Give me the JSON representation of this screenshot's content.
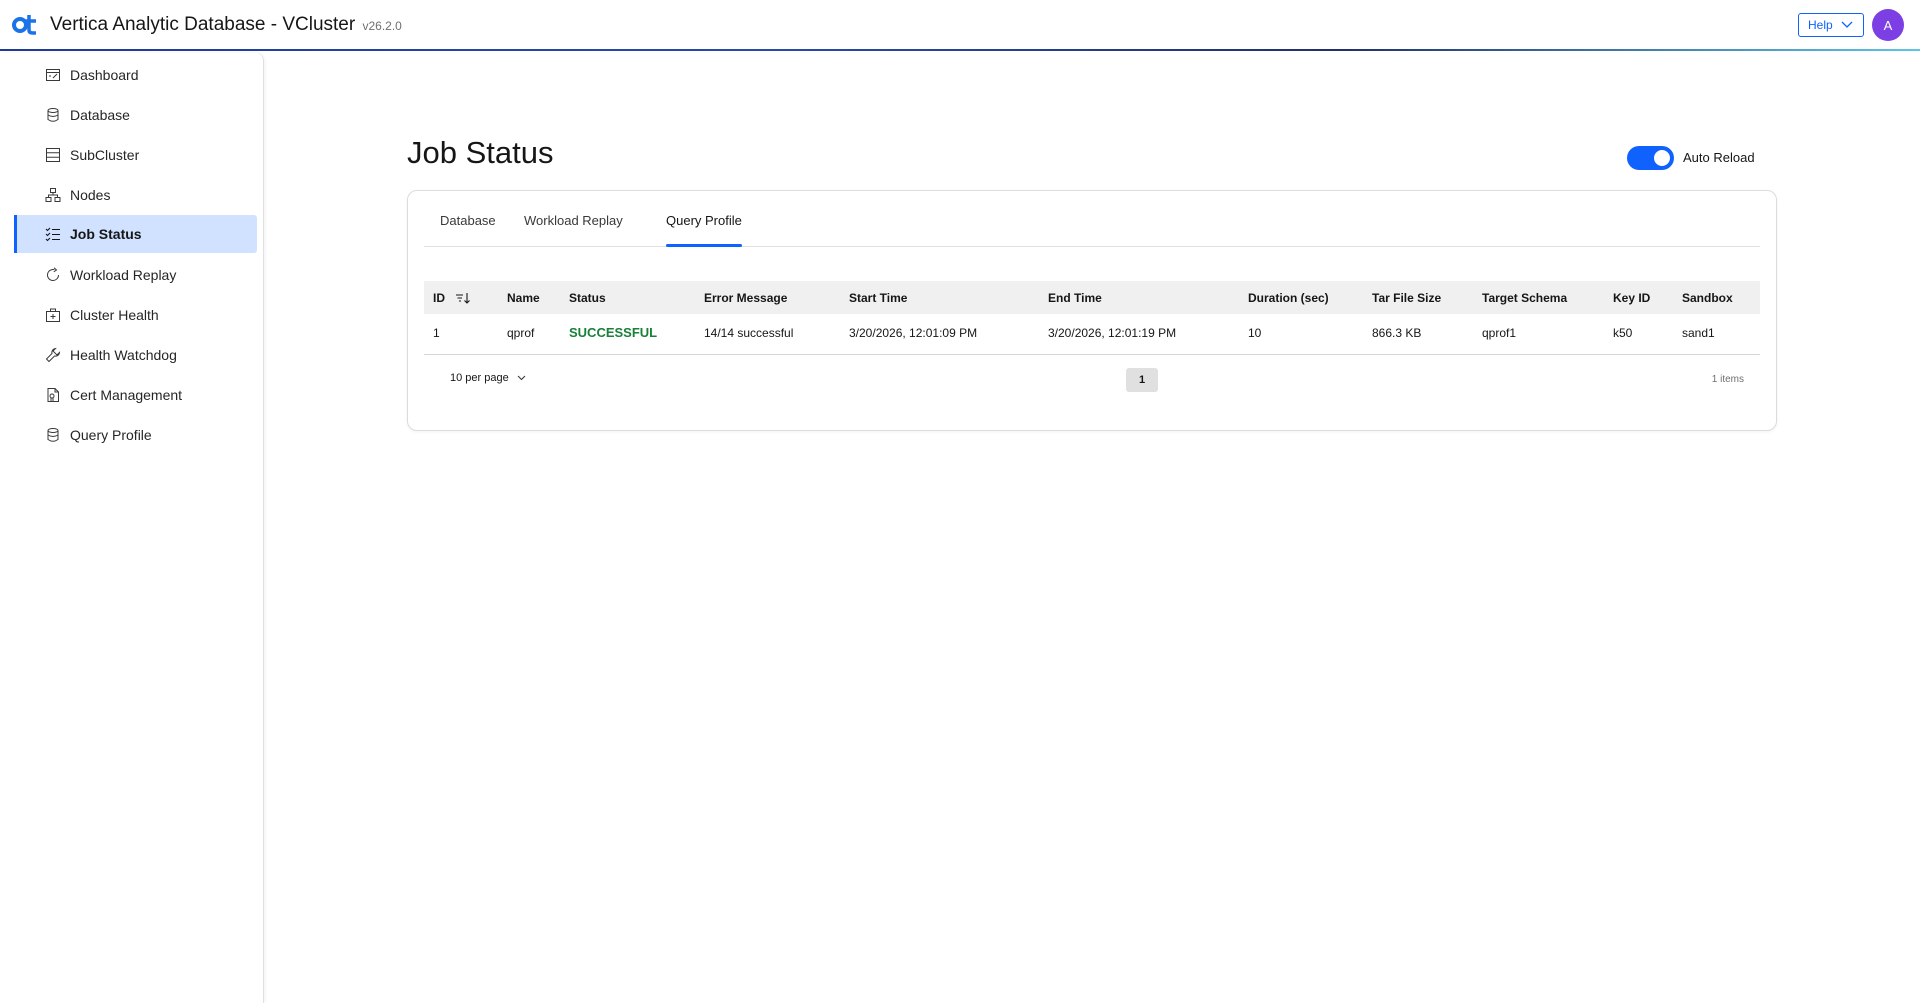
{
  "header": {
    "title": "Vertica Analytic Database - VCluster",
    "version": "v26.2.0",
    "help_label": "Help",
    "avatar_initial": "A"
  },
  "sidebar": {
    "items": [
      {
        "label": "Dashboard",
        "icon": "dashboard-icon"
      },
      {
        "label": "Database",
        "icon": "database-icon"
      },
      {
        "label": "SubCluster",
        "icon": "subcluster-icon"
      },
      {
        "label": "Nodes",
        "icon": "nodes-icon"
      },
      {
        "label": "Job Status",
        "icon": "job-status-icon",
        "active": true
      },
      {
        "label": "Workload Replay",
        "icon": "replay-icon"
      },
      {
        "label": "Cluster Health",
        "icon": "cluster-health-icon"
      },
      {
        "label": "Health Watchdog",
        "icon": "wrench-icon"
      },
      {
        "label": "Cert Management",
        "icon": "certificate-icon"
      },
      {
        "label": "Query Profile",
        "icon": "database-icon"
      }
    ]
  },
  "main": {
    "title": "Job Status",
    "auto_reload_label": "Auto Reload",
    "auto_reload_on": true,
    "tabs": [
      {
        "label": "Database"
      },
      {
        "label": "Workload Replay"
      },
      {
        "label": "Query Profile",
        "active": true
      }
    ],
    "table": {
      "columns": [
        "ID",
        "Name",
        "Status",
        "Error Message",
        "Start Time",
        "End Time",
        "Duration (sec)",
        "Tar File Size",
        "Target Schema",
        "Key ID",
        "Sandbox"
      ],
      "rows": [
        [
          "1",
          "qprof",
          "SUCCESSFUL",
          "14/14 successful",
          "3/20/2026, 12:01:09 PM",
          "3/20/2026, 12:01:19 PM",
          "10",
          "866.3 KB",
          "qprof1",
          "k50",
          "sand1"
        ]
      ]
    },
    "pagination": {
      "per_page": "10 per page",
      "current_page": "1",
      "items_count": "1 items"
    }
  },
  "colors": {
    "accent": "#0f62fe",
    "active_nav_bg": "#d0e2ff",
    "success": "#198038",
    "avatar": "#7b3fe4"
  }
}
